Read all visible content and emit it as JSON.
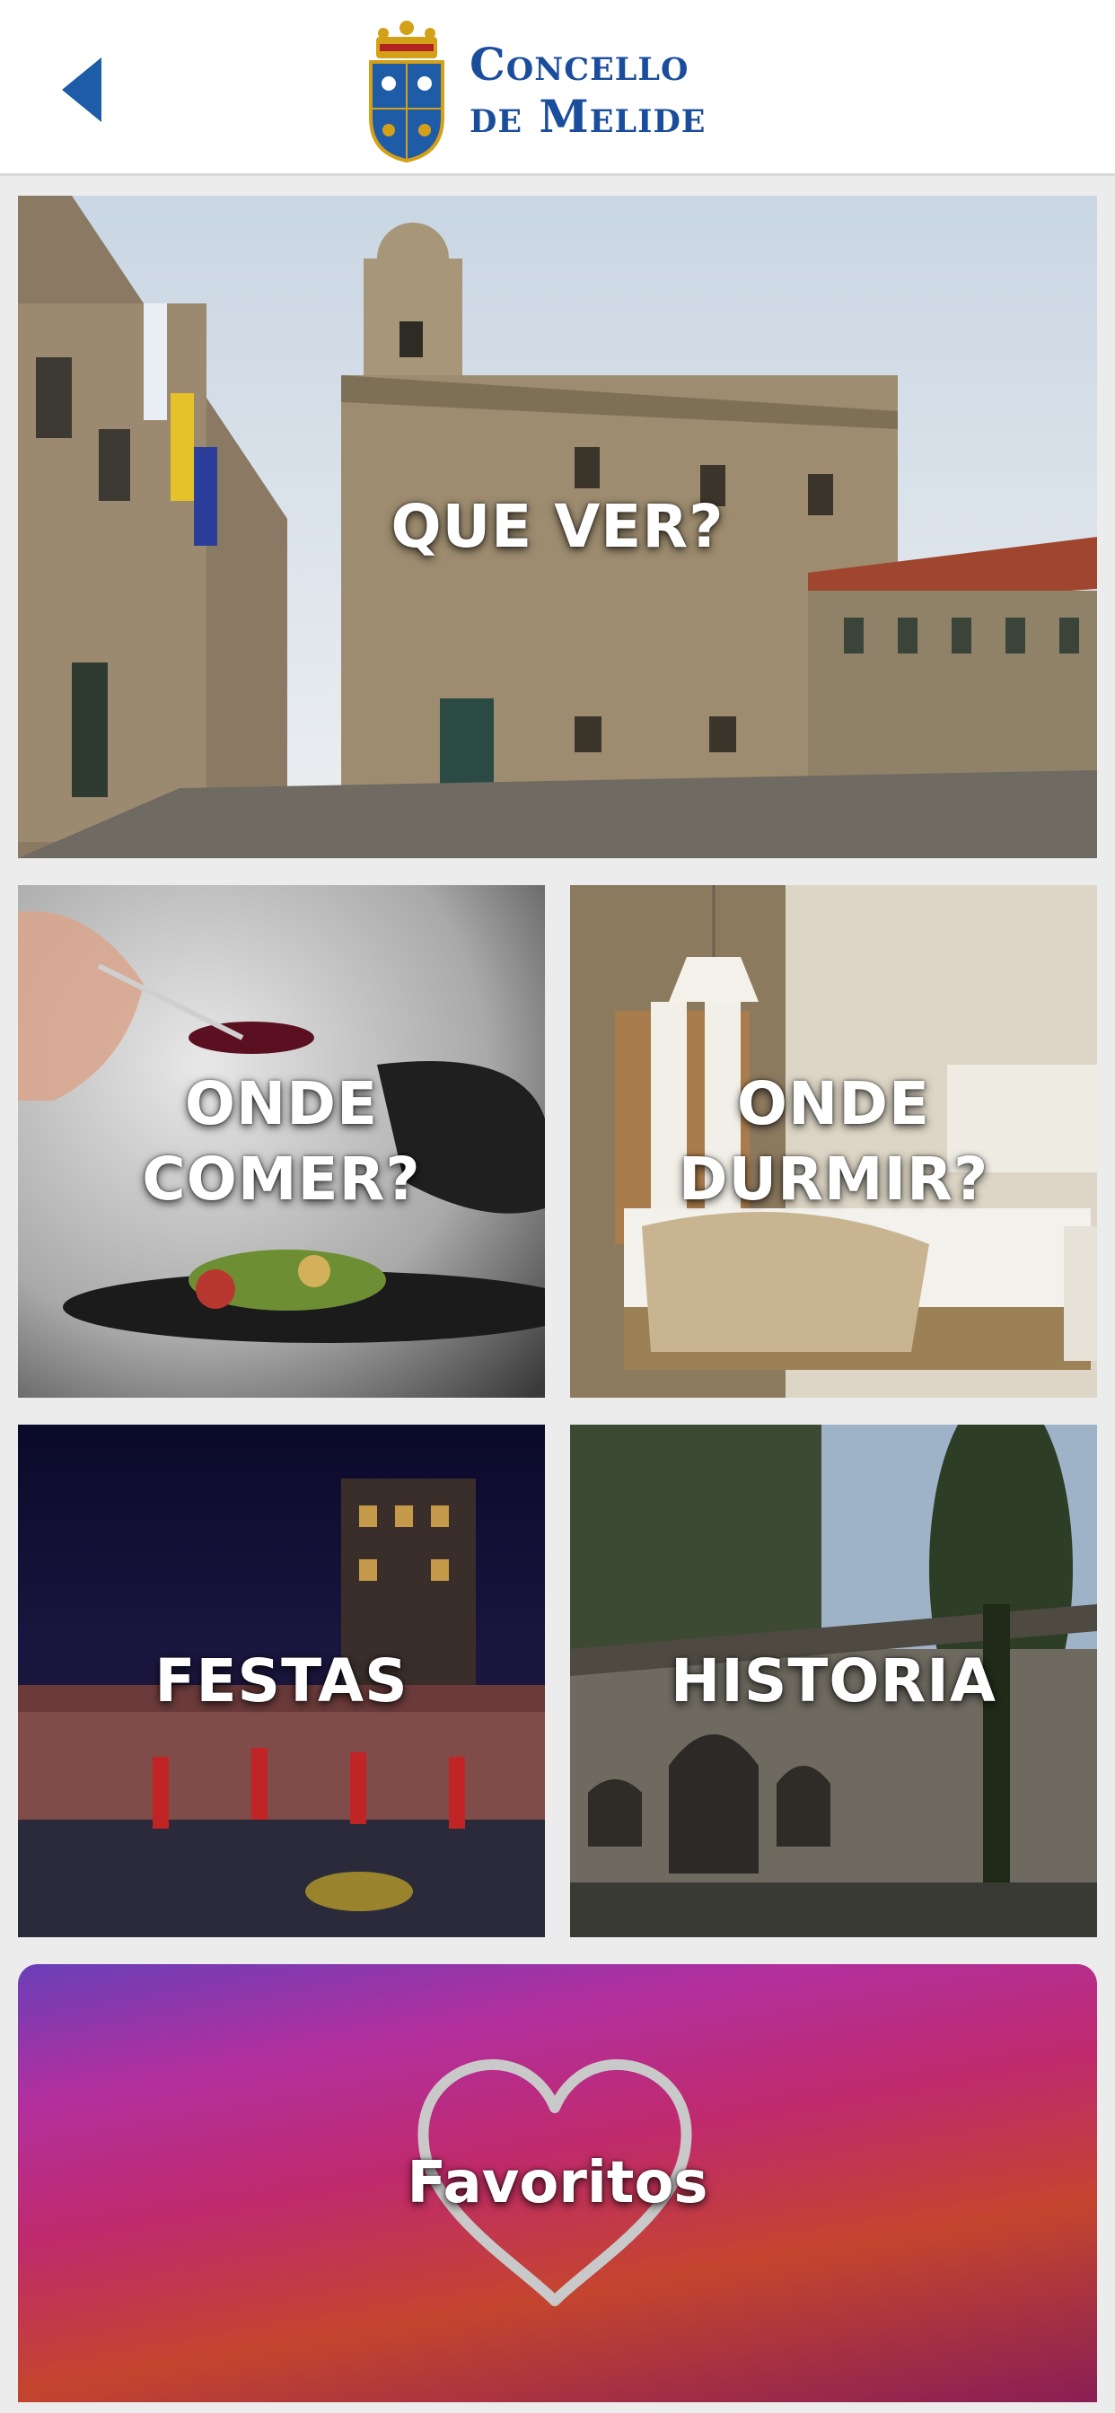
{
  "header": {
    "logo_line1": "Concello",
    "logo_line2": "de Melide"
  },
  "tiles": {
    "que_ver": "QUE VER?",
    "onde_comer": "ONDE\nCOMER?",
    "onde_durmir": "ONDE\nDURMIR?",
    "festas": "FESTAS",
    "historia": "HISTORIA",
    "favoritos": "Favoritos"
  },
  "icons": {
    "back": "back-chevron-icon",
    "crest": "crest-icon",
    "favorites": "heart-icon"
  },
  "colors": {
    "brand_blue": "#1a4d9c",
    "header_bg": "#ffffff",
    "page_bg": "#ececec"
  }
}
